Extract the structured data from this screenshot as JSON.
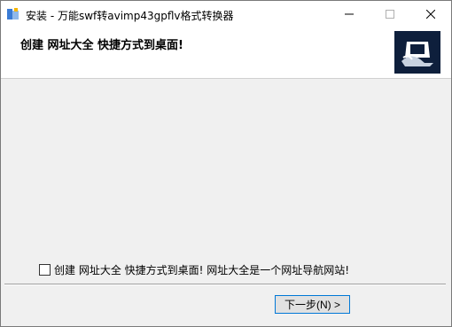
{
  "window": {
    "title": "安装 - 万能swf转avimp43gpflv格式转换器"
  },
  "header": {
    "title": "创建 网址大全 快捷方式到桌面!"
  },
  "options": {
    "shortcut_checkbox_label": "创建 网址大全 快捷方式到桌面! 网址大全是一个网址导航网站!",
    "shortcut_checked": false
  },
  "footer": {
    "next_label": "下一步(N) >"
  },
  "colors": {
    "titlebar": "#ffffff",
    "body": "#f0f0f0",
    "header_image_bg": "#0e1f3c",
    "focus_border": "#0078d7"
  }
}
